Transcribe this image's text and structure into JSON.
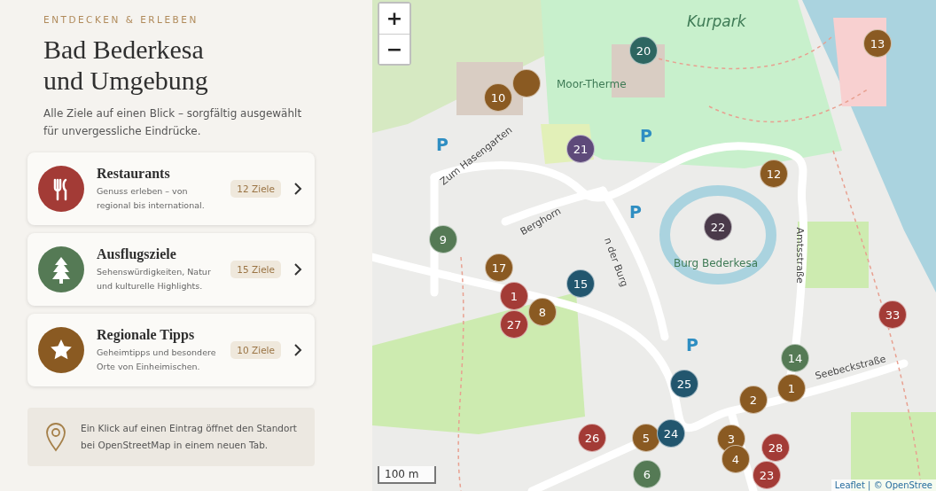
{
  "panel": {
    "eyebrow": "ENTDECKEN & ERLEBEN",
    "title_lines": [
      "Bad Bederkesa",
      "und Umgebung"
    ],
    "subtitle": "Alle Ziele auf einen Blick – sorgfältig ausgewählt für unvergessliche Eindrücke.",
    "categories": [
      {
        "kind": "restaurant",
        "title": "Restaurants",
        "description": "Genuss erleben – von regional bis international.",
        "count": "12 Ziele",
        "color": "#a33b36"
      },
      {
        "kind": "tree",
        "title": "Ausflugsziele",
        "description": "Sehenswürdigkeiten, Natur und kulturelle Highlights.",
        "count": "15 Ziele",
        "color": "#557a55"
      },
      {
        "kind": "star",
        "title": "Regionale Tipps",
        "description": "Geheimtipps und besondere Orte von Einheimischen.",
        "count": "10 Ziele",
        "color": "#8a5a22"
      }
    ],
    "info": "Ein Klick auf einen Eintrag öffnet den Standort bei OpenStreetMap in einem neuen Tab."
  },
  "map": {
    "zoom_in": "+",
    "zoom_out": "−",
    "scale": "100 m",
    "attribution": "Leaflet | © OpenStree",
    "labels": [
      {
        "kind": "park",
        "text": "Kurpark"
      },
      {
        "kind": "place",
        "text": "Moor-Therme"
      },
      {
        "kind": "place",
        "text": "Burg Bederkesa"
      },
      {
        "kind": "street",
        "text": "Zum Hasengarten"
      },
      {
        "kind": "street",
        "text": "Berghorn"
      },
      {
        "kind": "street",
        "text": "n der Burg"
      },
      {
        "kind": "street",
        "text": "Amtsstraße"
      },
      {
        "kind": "street",
        "text": "Seebeckstraße"
      },
      {
        "kind": "parking",
        "text": "P"
      },
      {
        "kind": "parking",
        "text": "P"
      },
      {
        "kind": "parking",
        "text": "P"
      },
      {
        "kind": "parking",
        "text": "P"
      }
    ],
    "markers": [
      {
        "label": "13",
        "color": "#8a5a22"
      },
      {
        "label": "20",
        "color": "#2e6661"
      },
      {
        "color": "#8a5a22"
      },
      {
        "label": "10",
        "color": "#8a5a22"
      },
      {
        "label": "21",
        "color": "#5e4a7a"
      },
      {
        "label": "12",
        "color": "#8a5a22"
      },
      {
        "label": "22",
        "color": "#4a3a4a"
      },
      {
        "label": "9",
        "color": "#557a55"
      },
      {
        "label": "17",
        "color": "#8a5a22"
      },
      {
        "label": "15",
        "color": "#22566e"
      },
      {
        "label": "1",
        "color": "#a33b36"
      },
      {
        "label": "8",
        "color": "#8a5a22"
      },
      {
        "label": "27",
        "color": "#a33b36"
      },
      {
        "label": "33",
        "color": "#a33b36"
      },
      {
        "label": "14",
        "color": "#557a55"
      },
      {
        "label": "25",
        "color": "#22566e"
      },
      {
        "label": "1",
        "color": "#8a5a22"
      },
      {
        "label": "2",
        "color": "#8a5a22"
      },
      {
        "label": "26",
        "color": "#a33b36"
      },
      {
        "label": "5",
        "color": "#8a5a22"
      },
      {
        "label": "24",
        "color": "#22566e"
      },
      {
        "label": "3",
        "color": "#8a5a22"
      },
      {
        "label": "28",
        "color": "#a33b36"
      },
      {
        "label": "4",
        "color": "#8a5a22"
      },
      {
        "label": "6",
        "color": "#557a55"
      },
      {
        "label": "23",
        "color": "#a33b36"
      }
    ]
  }
}
